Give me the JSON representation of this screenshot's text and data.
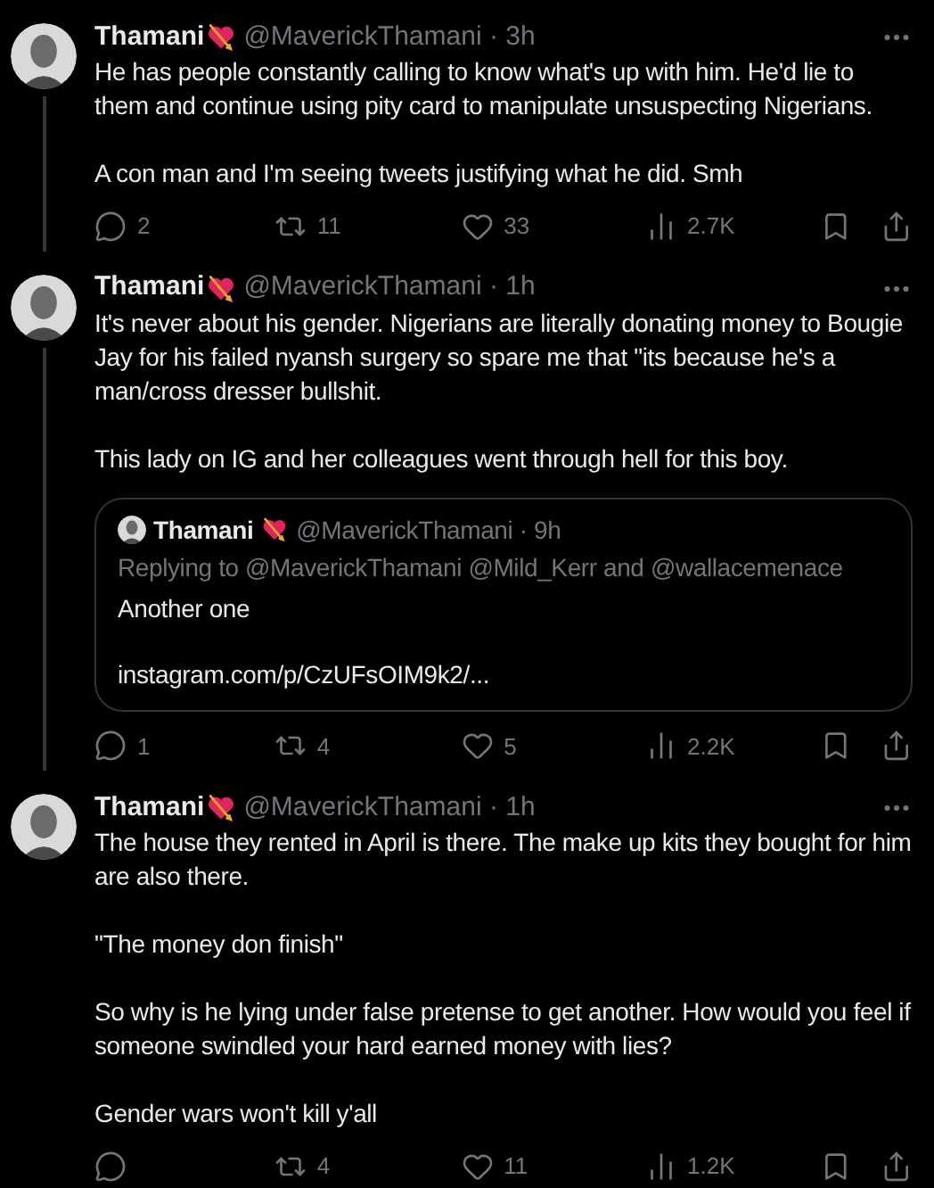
{
  "tweets": [
    {
      "name": "Thamani",
      "meta": "@MaverickThamani · 3h",
      "connected": true,
      "paragraphs": [
        "He has people constantly calling to know what's up with him. He'd lie to them and continue using pity card to manipulate unsuspecting Nigerians.",
        "A con man and I'm seeing tweets justifying what he did. Smh"
      ],
      "stats": {
        "replies": "2",
        "retweets": "11",
        "likes": "33",
        "views": "2.7K"
      }
    },
    {
      "name": "Thamani",
      "meta": "@MaverickThamani · 1h",
      "connected": true,
      "paragraphs": [
        "It's never about his gender. Nigerians are literally donating money to Bougie Jay for his failed nyansh surgery so spare me that \"its because he's a man/cross dresser bullshit.",
        "This lady on IG and her colleagues went through hell for this boy."
      ],
      "quote": {
        "name": "Thamani",
        "meta": "@MaverickThamani · 9h",
        "replying": "Replying to @MaverickThamani @Mild_Kerr and @wallacemenace",
        "paragraphs": [
          "Another one",
          "instagram.com/p/CzUFsOIM9k2/..."
        ]
      },
      "stats": {
        "replies": "1",
        "retweets": "4",
        "likes": "5",
        "views": "2.2K"
      }
    },
    {
      "name": "Thamani",
      "meta": "@MaverickThamani · 1h",
      "connected": false,
      "paragraphs": [
        "The house they rented in April is there. The make up kits they bought for him are also there.",
        "\"The money don finish\"",
        "So why is he lying under false pretense to get another. How would you feel if someone swindled your hard earned money with lies?",
        "Gender wars won't kill y'all"
      ],
      "stats": {
        "retweets": "4",
        "likes": "11",
        "views": "1.2K"
      }
    }
  ]
}
